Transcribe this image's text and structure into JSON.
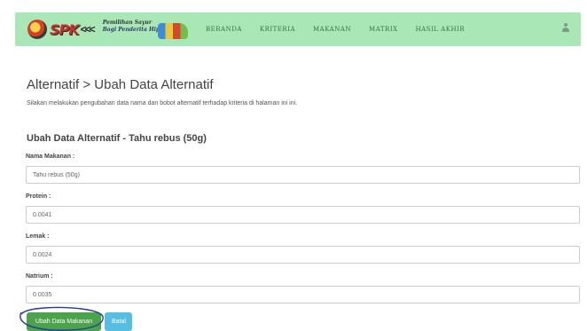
{
  "navbar": {
    "logo_text": "SPK",
    "logo_chevrons": "<<<",
    "logo_subtitle_1": "Pemilihan Sayur",
    "logo_subtitle_2": "Bagi Penderita Hipertensi",
    "links": [
      {
        "label": "BERANDA"
      },
      {
        "label": "KRITERIA"
      },
      {
        "label": "MAKANAN"
      },
      {
        "label": "MATRIX"
      },
      {
        "label": "HASIL AKHIR"
      }
    ],
    "bg_color": "#a9e8b6",
    "user_icon": "user-icon"
  },
  "page": {
    "title": "Alternatif > Ubah Data Alternatif",
    "description": "Silakan melakukan pengubahan data nama dan bobot alternatif terhadap kriteria di halaman ini ini."
  },
  "form": {
    "section_title": "Ubah Data Alternatif - Tahu rebus (50g)",
    "fields": [
      {
        "label": "Nama Makanan :",
        "value": "Tahu rebus (50g)"
      },
      {
        "label": "Protein :",
        "value": "0.0041"
      },
      {
        "label": "Lemak :",
        "value": "0.0024"
      },
      {
        "label": "Natrium :",
        "value": "0.0035"
      }
    ],
    "submit_label": "Ubah Data Makanan",
    "cancel_label": "Batal",
    "submit_color": "#4ba34b",
    "cancel_color": "#56bfe1"
  }
}
